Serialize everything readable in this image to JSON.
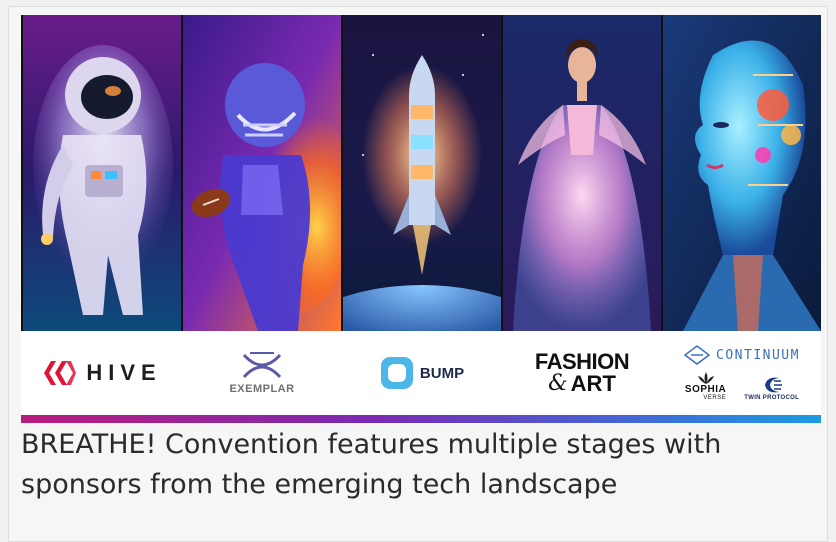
{
  "caption": "BREATHE! Convention features multiple stages with sponsors from the emerging tech landscape",
  "sponsors": {
    "hive": "HIVE",
    "exemplar": "EXEMPLAR",
    "bump": "BUMP",
    "fashion_line1": "FASHION",
    "fashion_amp": "&",
    "fashion_line2": "ART",
    "continuum": "CONTINUUM",
    "sophia": "SOPHIA",
    "sophia_sub": "VERSE",
    "twin": "TWIN PROTOCOL"
  },
  "panels": [
    {
      "subject": "astronaut"
    },
    {
      "subject": "football-player"
    },
    {
      "subject": "rocket"
    },
    {
      "subject": "fashion-model"
    },
    {
      "subject": "robot-woman"
    }
  ],
  "colors": {
    "hive_red": "#e31337",
    "bump_blue": "#4cb6e8",
    "continuum_blue": "#3a6fc4",
    "bar_start": "#b81c7e",
    "bar_end": "#1b9be0"
  }
}
